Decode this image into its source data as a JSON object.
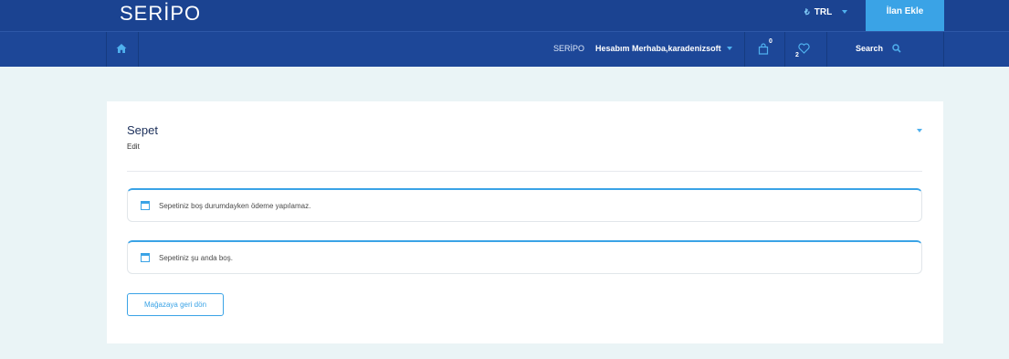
{
  "header": {
    "logo": "SERİPO",
    "currency_symbol": "₺",
    "currency": "TRL",
    "add_listing_label": "İlan Ekle"
  },
  "navbar": {
    "home_icon": "home-icon",
    "account_logo": "SERİPO",
    "account_label": "Hesabım Merhaba,karadenizsoft",
    "cart_count": "0",
    "wishlist_count": "2",
    "search_label": "Search"
  },
  "cart": {
    "title": "Sepet",
    "subtitle": "Edit",
    "notices": [
      "Sepetiniz boş durumdayken ödeme yapılamaz.",
      "Sepetiniz şu anda boş."
    ],
    "back_button": "Mağazaya geri dön"
  },
  "colors": {
    "header_bg": "#1b4391",
    "navbar_bg": "#1d4798",
    "accent": "#3aa3e6",
    "page_bg": "#eaf4f6"
  }
}
